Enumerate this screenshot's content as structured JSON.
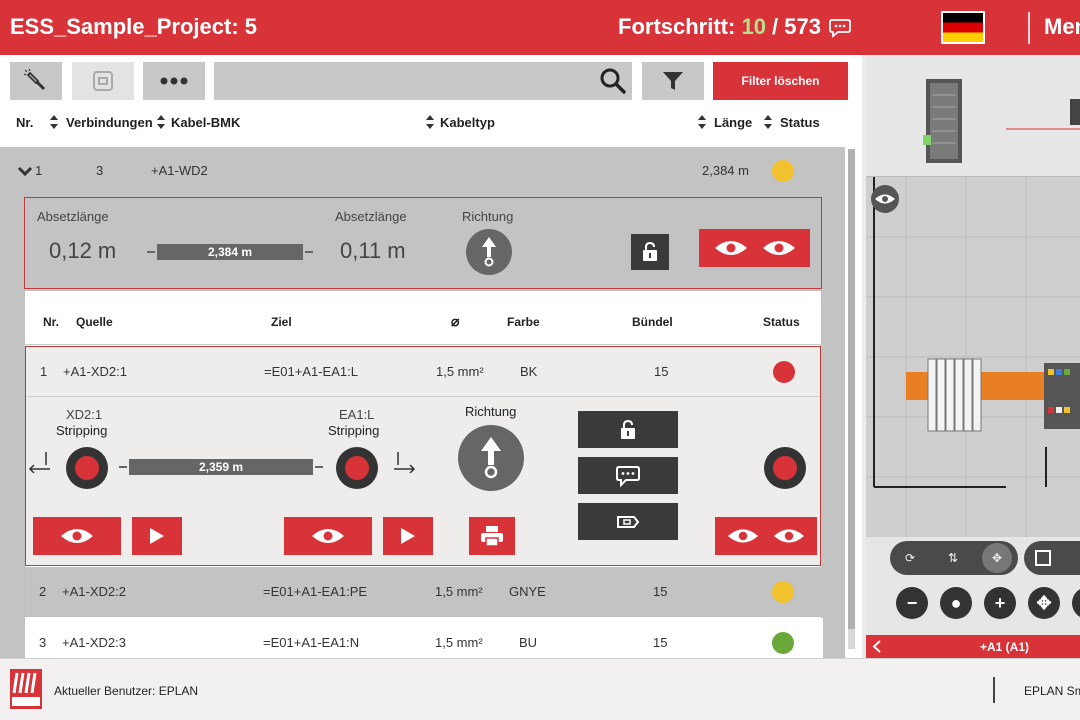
{
  "header": {
    "project_title": "ESS_Sample_Project: 5",
    "progress_label": "Fortschritt: ",
    "progress_done": "10",
    "progress_sep": " / ",
    "progress_total": "573",
    "menu_label": "Men"
  },
  "toolbar": {
    "filter_clear_label": "Filter löschen",
    "search_placeholder": ""
  },
  "table": {
    "columns": {
      "nr": "Nr.",
      "verbindungen": "Verbindungen",
      "kabel_bmk": "Kabel-BMK",
      "kabeltyp": "Kabeltyp",
      "laenge": "Länge",
      "status": "Status"
    },
    "group": {
      "nr": "1",
      "verbindungen": "3",
      "kabel_bmk": "+A1-WD2",
      "laenge": "2,384 m",
      "status_color": "#f2c12e"
    }
  },
  "cable": {
    "absetz_label_1": "Absetzlänge",
    "absetz_value_1": "0,12 m",
    "length": "2,384 m",
    "absetz_label_2": "Absetzlänge",
    "absetz_value_2": "0,11 m",
    "direction_label": "Richtung"
  },
  "connections": {
    "columns": {
      "nr": "Nr.",
      "quelle": "Quelle",
      "ziel": "Ziel",
      "diameter": "⌀",
      "farbe": "Farbe",
      "buendel": "Bündel",
      "status": "Status"
    },
    "rows": [
      {
        "nr": "1",
        "quelle": "+A1-XD2:1",
        "ziel": "=E01+A1-EA1:L",
        "diameter": "1,5 mm²",
        "farbe": "BK",
        "buendel": "15",
        "status_color": "#d9333a"
      },
      {
        "nr": "2",
        "quelle": "+A1-XD2:2",
        "ziel": "=E01+A1-EA1:PE",
        "diameter": "1,5 mm²",
        "farbe": "GNYE",
        "buendel": "15",
        "status_color": "#f2c12e"
      },
      {
        "nr": "3",
        "quelle": "+A1-XD2:3",
        "ziel": "=E01+A1-EA1:N",
        "diameter": "1,5 mm²",
        "farbe": "BU",
        "buendel": "15",
        "status_color": "#6aa83a"
      }
    ],
    "detail": {
      "source_terminal": "XD2:1",
      "source_process": "Stripping",
      "target_terminal": "EA1:L",
      "target_process": "Stripping",
      "wire_length": "2,359 m",
      "direction_label": "Richtung"
    }
  },
  "viewer": {
    "device_label": "+A1 (A1)"
  },
  "footer": {
    "current_user": "Aktueller Benutzer: EPLAN",
    "product": "EPLAN Sm"
  },
  "colors": {
    "brand_red": "#d9333a",
    "dark_button": "#3a3a3a",
    "grey_row": "#c3c3c3"
  }
}
